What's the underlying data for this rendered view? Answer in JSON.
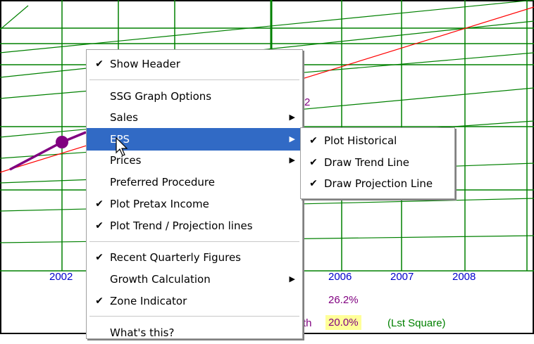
{
  "axis": {
    "years": [
      "2002",
      "2006",
      "2007",
      "2008"
    ],
    "year_color": "#0000cc"
  },
  "stats": {
    "growth_value_1": "26.2%",
    "growth_value_1_color": "#800080",
    "growth_value_2_label_partial": "th",
    "growth_value_2": "20.0%",
    "growth_value_2_highlight": "#ffff99",
    "method": "(Lst Square)",
    "method_color": "#008000",
    "line_marker": "2"
  },
  "colors": {
    "grid": "#008000",
    "trend": "#ff0000",
    "historical": "#800080",
    "highlight": "#316ac5"
  },
  "context_menu": {
    "items": [
      {
        "label": "Show Header",
        "checked": true
      },
      {
        "label": "SSG Graph Options"
      },
      {
        "label": "Sales",
        "submenu": true
      },
      {
        "label": "EPS",
        "submenu": true,
        "highlighted": true
      },
      {
        "label": "Prices",
        "submenu": true
      },
      {
        "label": "Preferred Procedure"
      },
      {
        "label": "Plot Pretax Income",
        "checked": true
      },
      {
        "label": "Plot Trend / Projection lines",
        "checked": true
      },
      {
        "label": "Recent Quarterly Figures",
        "checked": true
      },
      {
        "label": "Growth Calculation",
        "submenu": true
      },
      {
        "label": "Zone Indicator",
        "checked": true
      },
      {
        "label": "What's this?"
      }
    ]
  },
  "eps_submenu": {
    "items": [
      {
        "label": "Plot Historical",
        "checked": true
      },
      {
        "label": "Draw Trend Line",
        "checked": true
      },
      {
        "label": "Draw Projection Line",
        "checked": true
      }
    ]
  },
  "icons": {
    "check": "check-icon",
    "arrow": "submenu-arrow-icon",
    "cursor": "mouse-pointer-icon"
  }
}
